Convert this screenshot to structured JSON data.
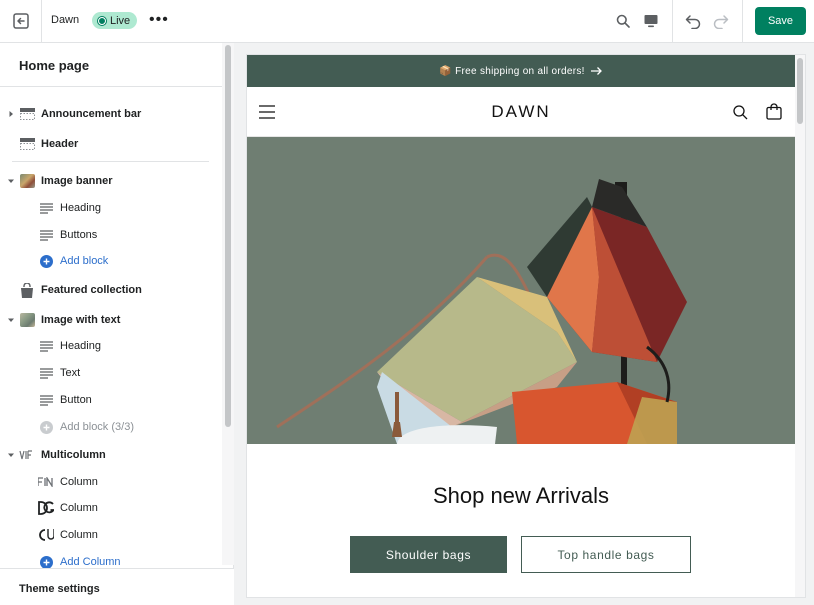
{
  "topbar": {
    "theme_name": "Dawn",
    "status_badge": "Live",
    "more": "•••",
    "save_label": "Save"
  },
  "sidebar": {
    "title": "Home page",
    "sections": [
      {
        "label": "Announcement bar"
      },
      {
        "label": "Header"
      },
      {
        "label": "Image banner"
      },
      {
        "label": "Heading"
      },
      {
        "label": "Buttons"
      },
      {
        "label": "Add block"
      },
      {
        "label": "Featured collection"
      },
      {
        "label": "Image with text"
      },
      {
        "label": "Heading"
      },
      {
        "label": "Text"
      },
      {
        "label": "Button"
      },
      {
        "label": "Add block (3/3)"
      },
      {
        "label": "Multicolumn"
      },
      {
        "label": "Column"
      },
      {
        "label": "Column"
      },
      {
        "label": "Column"
      },
      {
        "label": "Add Column"
      }
    ],
    "footer": "Theme settings"
  },
  "preview": {
    "announcement": "📦 Free shipping on all orders!",
    "logo": "DAWN",
    "rich_text_heading": "Shop new Arrivals",
    "button_primary": "Shoulder bags",
    "button_secondary": "Top handle bags"
  },
  "colors": {
    "accent": "#008060",
    "badge_bg": "#aee9d1",
    "store_primary": "#435c53",
    "link": "#2c6ecb"
  }
}
